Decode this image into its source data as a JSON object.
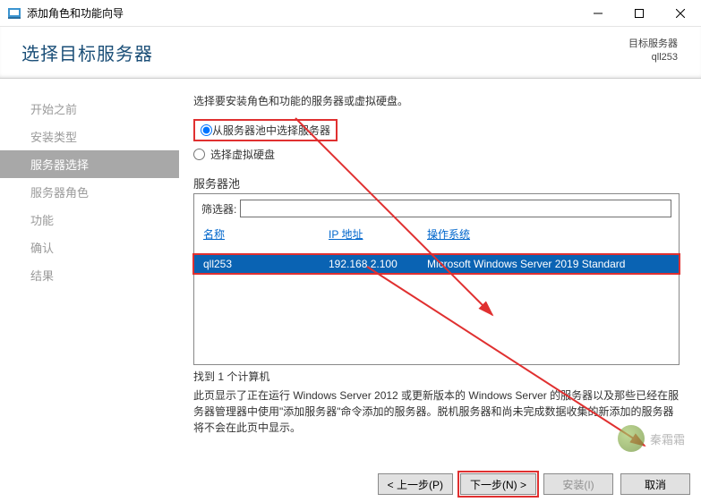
{
  "window": {
    "title": "添加角色和功能向导"
  },
  "header": {
    "page_title": "选择目标服务器",
    "dest_label": "目标服务器",
    "dest_value": "qll253"
  },
  "sidebar": {
    "items": [
      {
        "label": "开始之前"
      },
      {
        "label": "安装类型"
      },
      {
        "label": "服务器选择"
      },
      {
        "label": "服务器角色"
      },
      {
        "label": "功能"
      },
      {
        "label": "确认"
      },
      {
        "label": "结果"
      }
    ],
    "active_index": 2
  },
  "main": {
    "intro": "选择要安装角色和功能的服务器或虚拟硬盘。",
    "radio_pool": "从服务器池中选择服务器",
    "radio_vhd": "选择虚拟硬盘",
    "pool_label": "服务器池",
    "filter_label": "筛选器:",
    "filter_value": "",
    "columns": {
      "name": "名称",
      "ip": "IP 地址",
      "os": "操作系统"
    },
    "rows": [
      {
        "name": "qll253",
        "ip": "192.168.2.100",
        "os": "Microsoft Windows Server 2019 Standard"
      }
    ],
    "found": "找到 1 个计算机",
    "desc": "此页显示了正在运行 Windows Server 2012 或更新版本的 Windows Server 的服务器以及那些已经在服务器管理器中使用\"添加服务器\"命令添加的服务器。脱机服务器和尚未完成数据收集的新添加的服务器将不会在此页中显示。"
  },
  "buttons": {
    "prev": "< 上一步(P)",
    "next": "下一步(N) >",
    "install": "安装(I)",
    "cancel": "取消"
  },
  "watermark": "秦霜霜"
}
